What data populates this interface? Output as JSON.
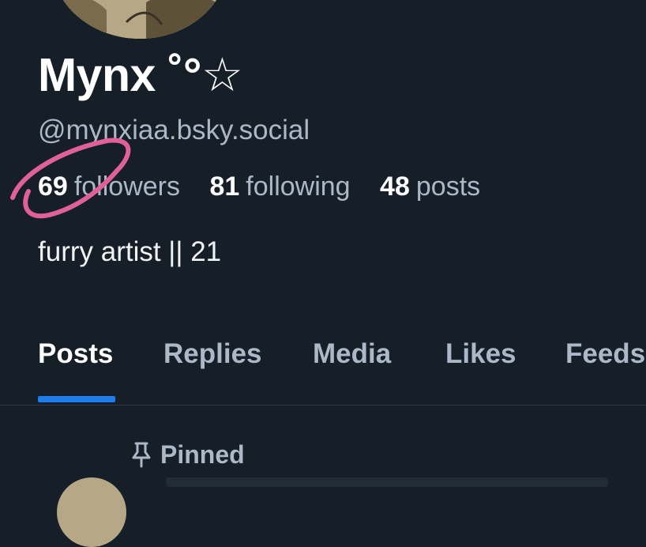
{
  "profile": {
    "display_name": "Mynx ˚°☆",
    "handle": "@mynxiaa.bsky.social",
    "bio": "furry artist || 21",
    "stats": {
      "followers_count": "69",
      "followers_label": "followers",
      "following_count": "81",
      "following_label": "following",
      "posts_count": "48",
      "posts_label": "posts"
    }
  },
  "tabs": [
    {
      "label": "Posts",
      "active": true
    },
    {
      "label": "Replies",
      "active": false
    },
    {
      "label": "Media",
      "active": false
    },
    {
      "label": "Likes",
      "active": false
    },
    {
      "label": "Feeds",
      "active": false
    }
  ],
  "feed": {
    "pinned_label": "Pinned",
    "pinned_icon": "pin-icon"
  },
  "colors": {
    "background": "#161e27",
    "accent": "#1c7cf0",
    "muted_text": "#aab8c7",
    "annotation": "#e0609a"
  }
}
